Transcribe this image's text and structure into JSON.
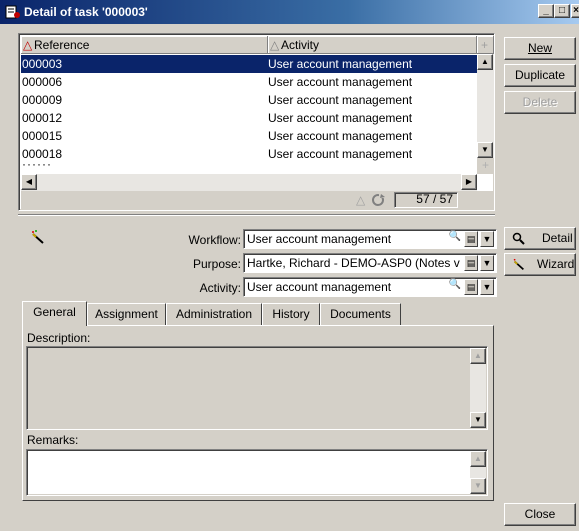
{
  "window": {
    "title": "Detail of task '000003'",
    "controls": [
      "_",
      "□",
      "×"
    ]
  },
  "list": {
    "columns": [
      "Reference",
      "Activity"
    ],
    "rows": [
      {
        "reference": "000003",
        "activity": "User account management",
        "selected": true
      },
      {
        "reference": "000006",
        "activity": "User account management"
      },
      {
        "reference": "000009",
        "activity": "User account management"
      },
      {
        "reference": "000012",
        "activity": "User account management"
      },
      {
        "reference": "000015",
        "activity": "User account management"
      },
      {
        "reference": "000018",
        "activity": "User account management"
      }
    ],
    "count": "57 / 57"
  },
  "buttons": {
    "new": "New",
    "duplicate": "Duplicate",
    "delete": "Delete",
    "detail": "Detail",
    "wizard": "Wizard",
    "close": "Close"
  },
  "form": {
    "workflow_label": "Workflow:",
    "workflow_value": "User account management",
    "purpose_label": "Purpose:",
    "purpose_value": "Hartke, Richard - DEMO-ASP0 (Notes v",
    "activity_label": "Activity:",
    "activity_value": "User account management"
  },
  "tabs": [
    "General",
    "Assignment",
    "Administration",
    "History",
    "Documents"
  ],
  "general": {
    "description_label": "Description:",
    "description_value": "",
    "remarks_label": "Remarks:",
    "remarks_value": ""
  },
  "colors": {
    "title_bar": "#0a246a",
    "selection": "#0a246a",
    "dialog_bg": "#d4d0c8"
  }
}
